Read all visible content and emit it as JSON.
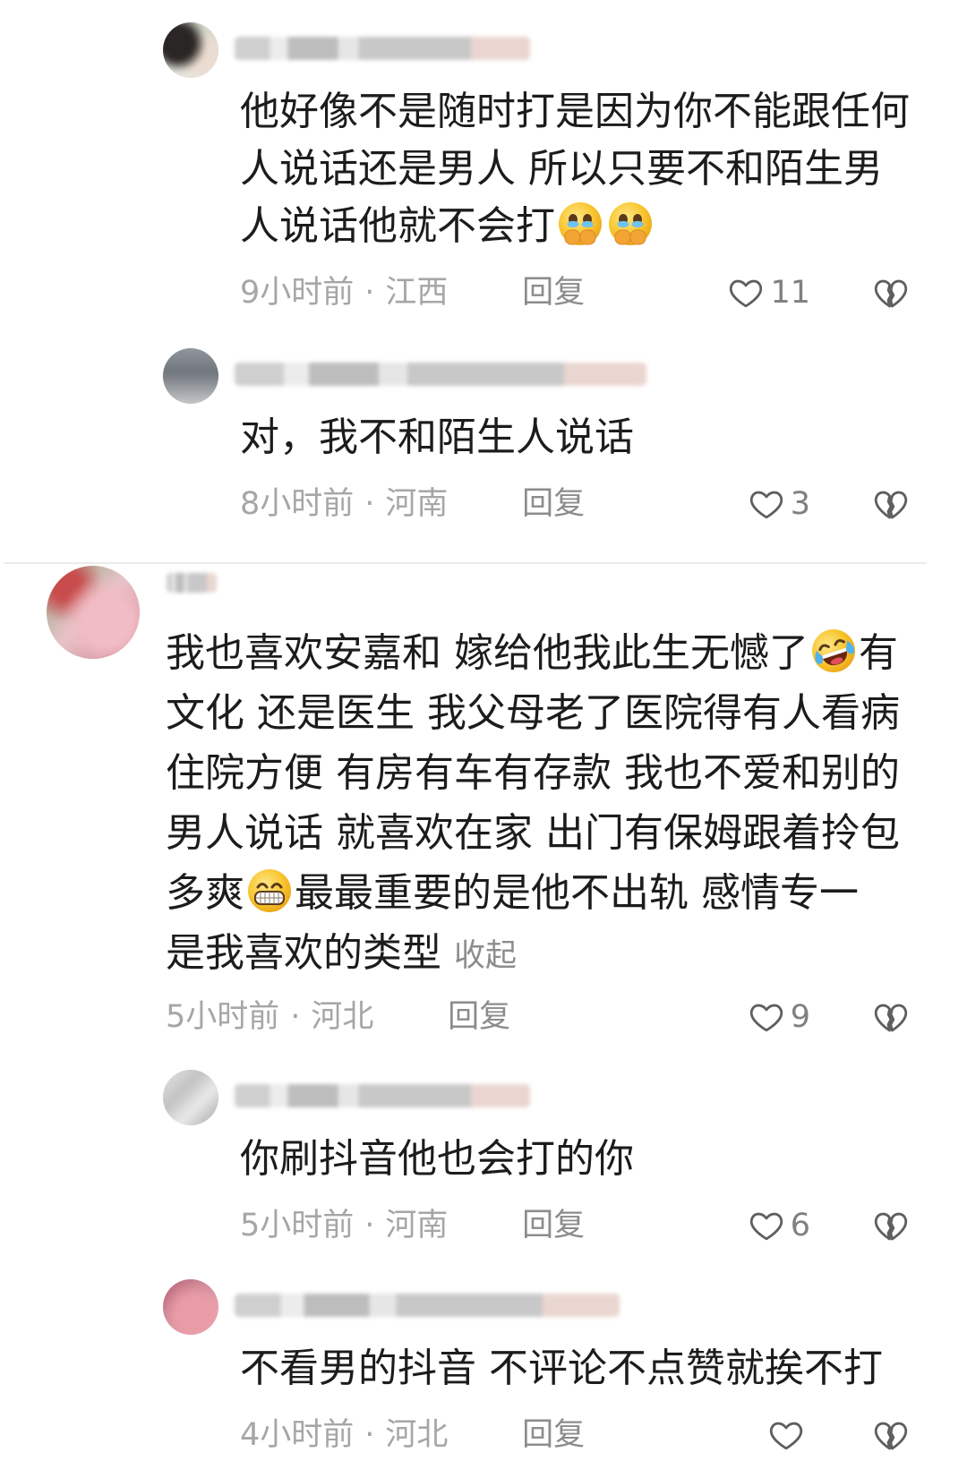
{
  "theme": {
    "background": "#ffffff",
    "text": "#1c1c1e",
    "meta_text": "#a6a6a6",
    "reply_text": "#8c8c8c",
    "count_text": "#808080",
    "icon": "#5e5e5e",
    "divider": "#ebebeb",
    "collapse_text": "#8c8c8c"
  },
  "icons": {
    "like": "heart-outline-icon",
    "dislike": "broken-heart-icon"
  },
  "meta_separator": "·",
  "comments": [
    {
      "level": "reply",
      "lines": [
        [
          "他好像不是随时打是因为你不能跟任何"
        ],
        [
          "人说话还是男人 所以只要不和陌生男"
        ],
        [
          "人说话他就不会打"
        ]
      ],
      "emojis": [
        "holding-back-tears-emoji",
        "holding-back-tears-emoji"
      ],
      "time": "9小时前",
      "location": "江西",
      "reply_label": "回复",
      "likes": "11"
    },
    {
      "level": "reply",
      "lines": [
        [
          "对，我不和陌生人说话"
        ]
      ],
      "time": "8小时前",
      "location": "河南",
      "reply_label": "回复",
      "likes": "3"
    },
    {
      "level": "top",
      "lines": [
        [
          "我也喜欢安嘉和 嫁给他我此生无憾了",
          "有"
        ],
        [
          "文化 还是医生 我父母老了医院得有人看病"
        ],
        [
          "住院方便 有房有车有存款 我也不爱和别的"
        ],
        [
          "男人说话 就喜欢在家 出门有保姆跟着拎包"
        ],
        [
          "多爽",
          "最最重要的是他不出轨 感情专一"
        ],
        [
          "是我喜欢的类型"
        ]
      ],
      "emojis": [
        "laughing-tears-emoji",
        "grinning-emoji"
      ],
      "collapse_label": "收起",
      "time": "5小时前",
      "location": "河北",
      "reply_label": "回复",
      "likes": "9"
    },
    {
      "level": "reply",
      "lines": [
        [
          "你刷抖音他也会打的你"
        ]
      ],
      "time": "5小时前",
      "location": "河南",
      "reply_label": "回复",
      "likes": "6"
    },
    {
      "level": "reply",
      "lines": [
        [
          "不看男的抖音 不评论不点赞就挨不打"
        ]
      ],
      "time": "4小时前",
      "location": "河北",
      "reply_label": "回复"
    }
  ]
}
